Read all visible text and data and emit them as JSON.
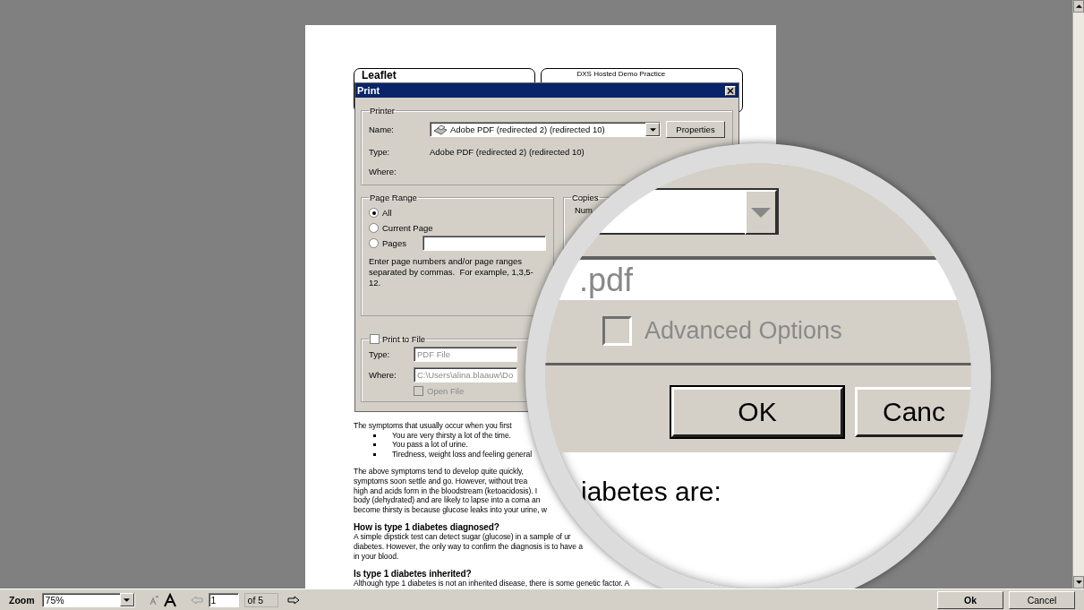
{
  "document": {
    "header_left": "Leaflet",
    "header_right": "DXS Hosted Demo Practice",
    "paragraphs": [
      [
        {
          "kind": "line",
          "text": "The symptoms that usually occur when you first"
        },
        {
          "kind": "bullet",
          "text": "You are very thirsty a lot of the time."
        },
        {
          "kind": "bullet",
          "text": "You pass a lot of urine."
        },
        {
          "kind": "bullet",
          "text": "Tiredness, weight loss and feeling general"
        }
      ],
      [
        {
          "kind": "line",
          "text": "The above symptoms tend to develop quite quickly,"
        },
        {
          "kind": "line",
          "text": "symptoms soon settle and go. However, without trea"
        },
        {
          "kind": "line",
          "text": "high and acids form in the bloodstream (ketoacidosis). I"
        },
        {
          "kind": "line",
          "text": "body (dehydrated) and are likely to lapse into a coma an"
        },
        {
          "kind": "line",
          "text": "become thirsty is because glucose leaks into your urine, w"
        }
      ],
      [
        {
          "kind": "heading",
          "text": "How is type 1 diabetes diagnosed?"
        },
        {
          "kind": "line",
          "text": "A simple dipstick test can detect sugar (glucose) in a sample of ur"
        },
        {
          "kind": "line",
          "text": "diabetes. However, the only way to confirm the diagnosis is to have a"
        },
        {
          "kind": "line",
          "text": "in your blood."
        }
      ],
      [
        {
          "kind": "heading",
          "text": "Is type 1 diabetes inherited?"
        },
        {
          "kind": "line",
          "text": "Although type 1 diabetes is not an inherited disease, there is some genetic factor. A"
        }
      ]
    ]
  },
  "print_dialog": {
    "title": "Print",
    "printer": {
      "legend": "Printer",
      "name_label": "Name:",
      "name_value": "Adobe PDF (redirected 2) (redirected 10)",
      "properties": "Properties",
      "type_label": "Type:",
      "type_value": "Adobe PDF (redirected 2) (redirected 10)",
      "where_label": "Where:"
    },
    "page_range": {
      "legend": "Page Range",
      "options": [
        {
          "label": "All",
          "selected": true
        },
        {
          "label": "Current Page",
          "selected": false
        },
        {
          "label": "Pages",
          "selected": false
        }
      ],
      "hint": "Enter page numbers and/or page ranges separated by commas.  For example, 1,3,5-12."
    },
    "copies": {
      "legend": "Copies",
      "label": "Num"
    },
    "print_to_file": {
      "label": "Print to File",
      "checked": false,
      "type_label": "Type:",
      "type_value": "PDF File",
      "where_label": "Where:",
      "where_value": "C:\\Users\\alina.blaauw\\Do",
      "open_file": {
        "label": "Open File",
        "checked": false,
        "disabled": true
      }
    }
  },
  "magnifier": {
    "path_suffix": ".pdf",
    "advanced": {
      "label": "Advanced Options",
      "checked": false,
      "disabled": true
    },
    "ok": "OK",
    "cancel": "Canc",
    "page_text": "iabetes are:"
  },
  "toolbar": {
    "zoom_label": "Zoom",
    "zoom_value": "75%",
    "page_value": "1",
    "page_count": "of 5",
    "ok": "Ok",
    "cancel": "Cancel"
  }
}
